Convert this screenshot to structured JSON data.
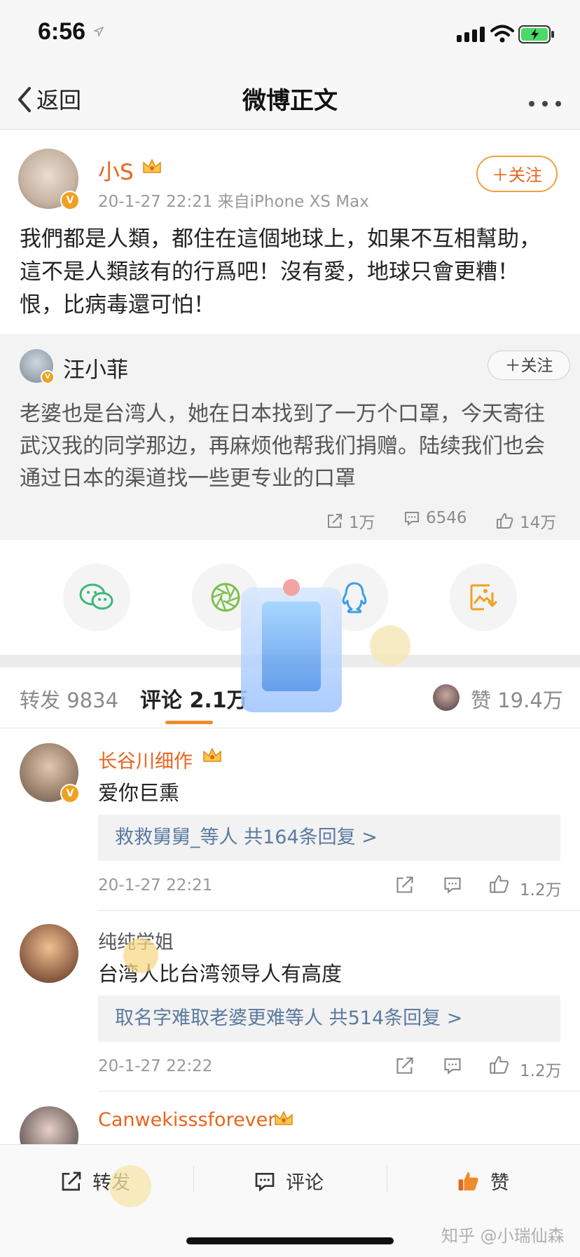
{
  "status_bar": {
    "time": "6:56"
  },
  "nav": {
    "back_label": "返回",
    "title": "微博正文"
  },
  "post": {
    "author": "小S",
    "meta": "20-1-27 22:21  来自iPhone XS Max",
    "follow_label": "＋关注",
    "text": "我們都是人類，都住在這個地球上，如果不互相幫助，這不是人類該有的行爲吧！沒有愛，地球只會更糟！恨，比病毒還可怕！"
  },
  "repost": {
    "author": "汪小菲",
    "follow_label": "＋关注",
    "text": "老婆也是台湾人，她在日本找到了一万个口罩，今天寄往武汉我的同学那边，再麻烦他帮我们捐赠。陆续我们也会通过日本的渠道找一些更专业的口罩",
    "shares": "1万",
    "comments": "6546",
    "likes": "14万"
  },
  "tabs": {
    "repost": "转发 9834",
    "comments": "评论 2.1万",
    "likes": "赞 19.4万"
  },
  "comments": [
    {
      "name": "长谷川细作",
      "text": "爱你巨熏",
      "replies": "救救舅舅_等人  共164条回复 >",
      "time": "20-1-27 22:21",
      "likes": "1.2万"
    },
    {
      "name": "纯纯学姐",
      "text": "台湾人比台湾领导人有高度",
      "replies": "取名字难取老婆更难等人  共514条回复 >",
      "time": "20-1-27 22:22",
      "likes": "1.2万"
    },
    {
      "name": "Canwekisssforever",
      "text": ""
    }
  ],
  "bottom_bar": {
    "repost": "转发",
    "comment": "评论",
    "like": "赞"
  },
  "watermark": "知乎 @小瑞仙森",
  "colors": {
    "accent": "#e8641c",
    "link": "#5b7aa0",
    "like_orange": "#f08a2a"
  }
}
